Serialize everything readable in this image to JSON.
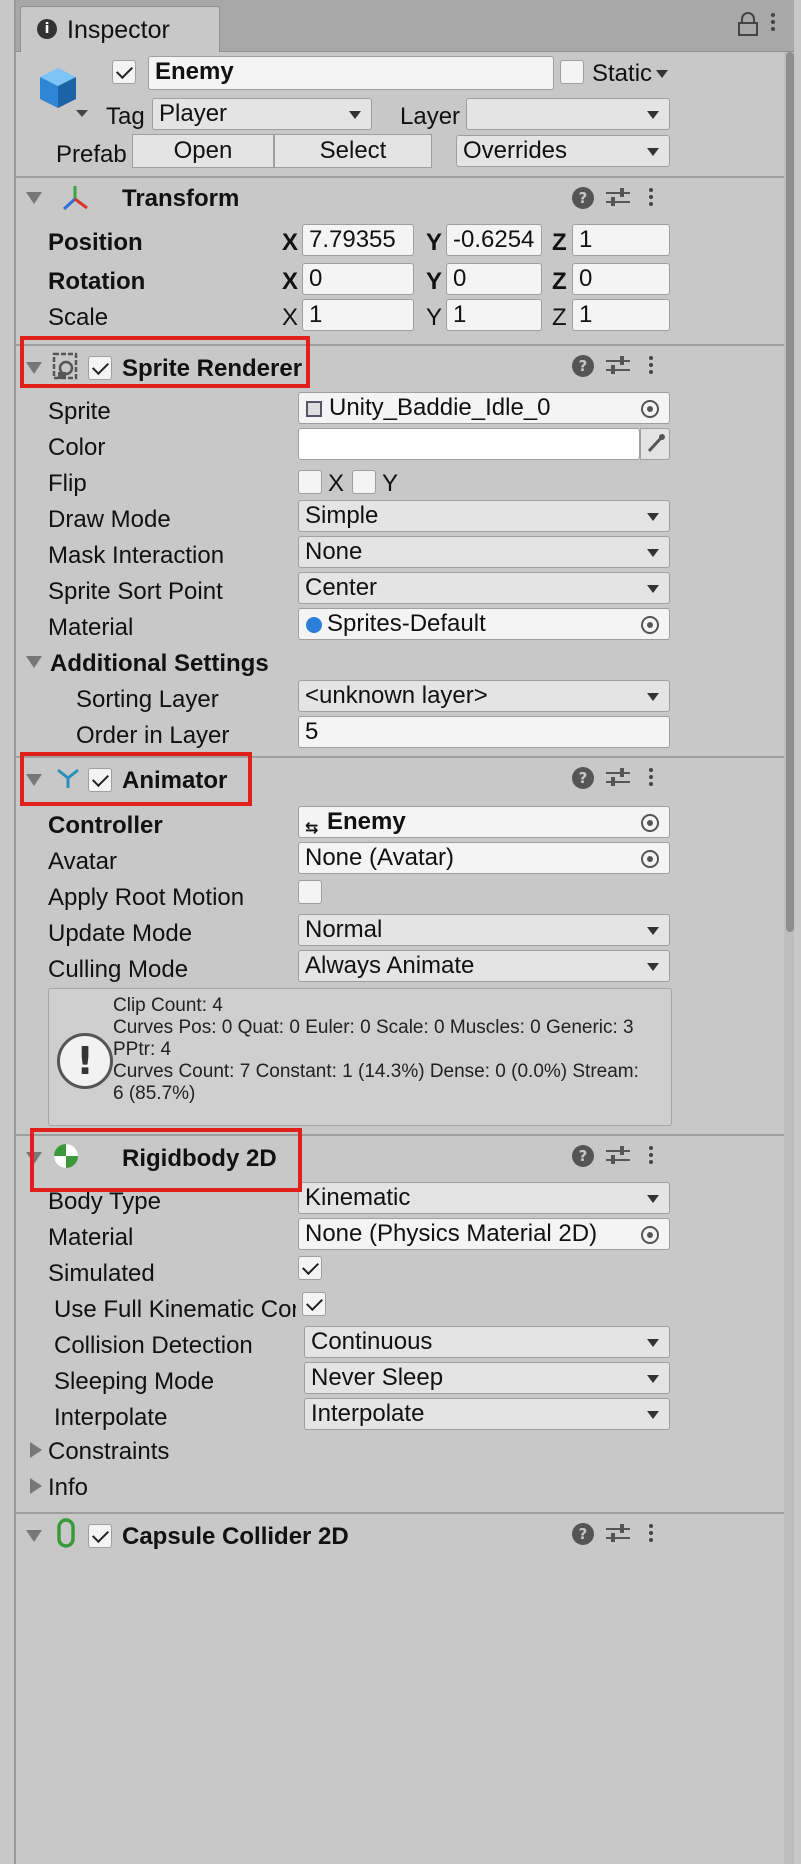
{
  "window": {
    "tab_title": "Inspector"
  },
  "header": {
    "active": true,
    "name": "Enemy",
    "static_checked": false,
    "static_label": "Static",
    "tag_label": "Tag",
    "tag_value": "Player",
    "layer_label": "Layer",
    "layer_value": "",
    "prefab_label": "Prefab",
    "open_label": "Open",
    "select_label": "Select",
    "overrides_label": "Overrides"
  },
  "transform": {
    "title": "Transform",
    "position_label": "Position",
    "rotation_label": "Rotation",
    "scale_label": "Scale",
    "axis_x": "X",
    "axis_y": "Y",
    "axis_z": "Z",
    "position": {
      "x": "7.79355",
      "y": "-0.6254",
      "z": "1"
    },
    "rotation": {
      "x": "0",
      "y": "0",
      "z": "0"
    },
    "scale": {
      "x": "1",
      "y": "1",
      "z": "1"
    }
  },
  "sprite_renderer": {
    "title": "Sprite Renderer",
    "enabled": true,
    "sprite_label": "Sprite",
    "sprite_value": "Unity_Baddie_Idle_0",
    "color_label": "Color",
    "color_value": "#FFFFFF",
    "flip_label": "Flip",
    "flip_x_label": "X",
    "flip_y_label": "Y",
    "draw_mode_label": "Draw Mode",
    "draw_mode_value": "Simple",
    "mask_label": "Mask Interaction",
    "mask_value": "None",
    "sort_point_label": "Sprite Sort Point",
    "sort_point_value": "Center",
    "material_label": "Material",
    "material_value": "Sprites-Default",
    "additional_label": "Additional Settings",
    "sorting_layer_label": "Sorting Layer",
    "sorting_layer_value": "<unknown layer>",
    "order_label": "Order in Layer",
    "order_value": "5"
  },
  "animator": {
    "title": "Animator",
    "enabled": true,
    "controller_label": "Controller",
    "controller_value": "Enemy",
    "avatar_label": "Avatar",
    "avatar_value": "None (Avatar)",
    "root_motion_label": "Apply Root Motion",
    "root_motion": false,
    "update_mode_label": "Update Mode",
    "update_mode_value": "Normal",
    "culling_label": "Culling Mode",
    "culling_value": "Always Animate",
    "info_lines": [
      "Clip Count: 4",
      "Curves Pos: 0 Quat: 0 Euler: 0 Scale: 0 Muscles: 0 Generic: 3",
      "PPtr: 4",
      "Curves Count: 7 Constant: 1 (14.3%) Dense: 0 (0.0%) Stream:",
      "6 (85.7%)"
    ]
  },
  "rigidbody": {
    "title": "Rigidbody 2D",
    "body_type_label": "Body Type",
    "body_type_value": "Kinematic",
    "material_label": "Material",
    "material_value": "None (Physics Material 2D)",
    "simulated_label": "Simulated",
    "simulated": true,
    "full_kinematic_label": "Use Full Kinematic Cor",
    "full_kinematic": true,
    "collision_label": "Collision Detection",
    "collision_value": "Continuous",
    "sleeping_label": "Sleeping Mode",
    "sleeping_value": "Never Sleep",
    "interpolate_label": "Interpolate",
    "interpolate_value": "Interpolate",
    "constraints_label": "Constraints",
    "info_label": "Info"
  },
  "capsule": {
    "title": "Capsule Collider 2D",
    "enabled": true
  },
  "colors": {
    "highlight_box": "#e0201a",
    "panel_bg": "#c8c8c8",
    "field_bg": "#f4f4f4"
  }
}
